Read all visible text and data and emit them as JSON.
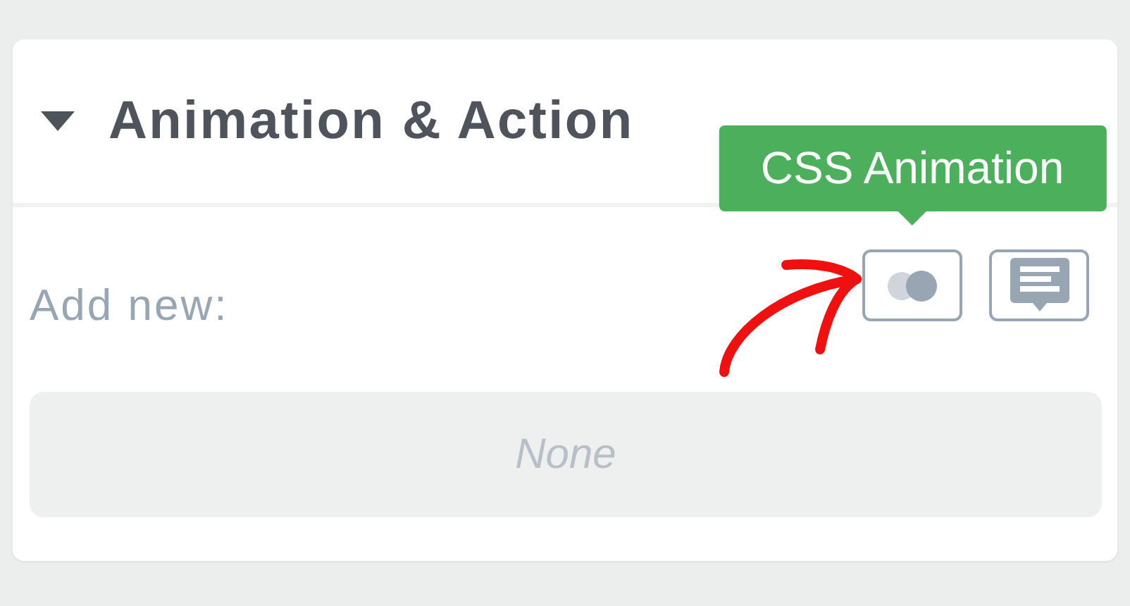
{
  "section": {
    "title": "Animation & Action",
    "expanded": true
  },
  "add_new": {
    "label": "Add new:",
    "buttons": [
      {
        "kind": "animation",
        "tooltip": "CSS Animation"
      },
      {
        "kind": "message"
      }
    ]
  },
  "list": {
    "empty_text": "None"
  }
}
